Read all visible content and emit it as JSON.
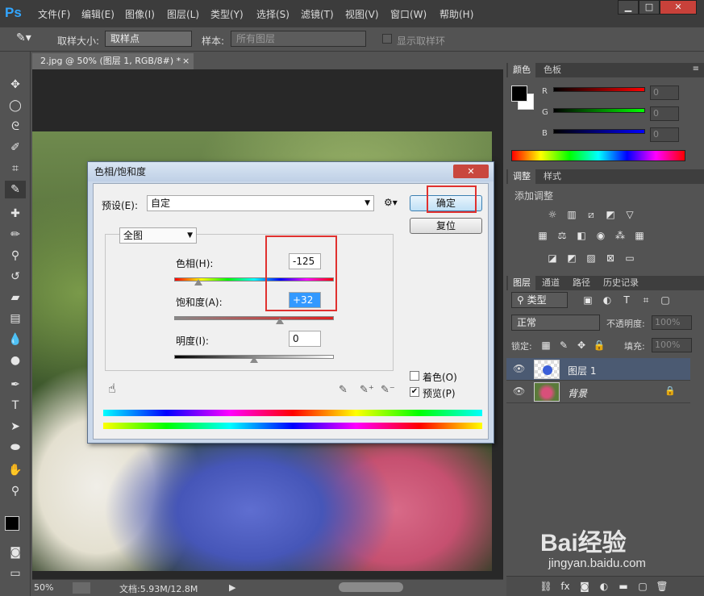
{
  "app": {
    "logo": "Ps"
  },
  "menu": [
    "文件(F)",
    "编辑(E)",
    "图像(I)",
    "图层(L)",
    "类型(Y)",
    "选择(S)",
    "滤镜(T)",
    "视图(V)",
    "窗口(W)",
    "帮助(H)"
  ],
  "window_controls": {
    "minimize": "▁",
    "restore": "□",
    "close": "✕"
  },
  "options": {
    "sample_size_label": "取样大小:",
    "sample_size_value": "取样点",
    "sample_label": "样本:",
    "sample_value": "所有图层",
    "show_ring_label": "显示取样环"
  },
  "document": {
    "tab_title": "2.jpg @ 50% (图层 1, RGB/8#) *",
    "tab_close": "×"
  },
  "status": {
    "zoom": "50%",
    "doc_info": "文档:5.93M/12.8M"
  },
  "color_panel": {
    "tabs": [
      "颜色",
      "色板"
    ],
    "channels": [
      {
        "label": "R",
        "value": "0"
      },
      {
        "label": "G",
        "value": "0"
      },
      {
        "label": "B",
        "value": "0"
      }
    ]
  },
  "adjust_panel": {
    "tabs": [
      "调整",
      "样式"
    ],
    "hint": "添加调整"
  },
  "layers_panel": {
    "tabs": [
      "图层",
      "通道",
      "路径",
      "历史记录"
    ],
    "filter_kind": "类型",
    "blend_mode": "正常",
    "opacity_label": "不透明度:",
    "opacity_value": "100%",
    "lock_label": "锁定:",
    "fill_label": "填充:",
    "fill_value": "100%",
    "layers": [
      {
        "name": "图层 1",
        "selected": true
      },
      {
        "name": "背景",
        "selected": false
      }
    ]
  },
  "dialog": {
    "title": "色相/饱和度",
    "close": "✕",
    "preset_label": "预设(E):",
    "preset_value": "自定",
    "ok_button": "确定",
    "reset_button": "复位",
    "channel_value": "全图",
    "hue_label": "色相(H):",
    "hue_value": "-125",
    "hue_level": -125,
    "saturation_label": "饱和度(A):",
    "saturation_value": "+32",
    "saturation_level": 32,
    "lightness_label": "明度(I):",
    "lightness_value": "0",
    "lightness_level": 0,
    "colorize_label": "着色(O)",
    "colorize_checked": false,
    "preview_label": "预览(P)",
    "preview_checked": true,
    "preview_check_mark": "✔"
  },
  "watermark": {
    "text": "Bai经验",
    "url": "jingyan.baidu.com"
  },
  "colors": {
    "highlight": "#e0312f",
    "accent_blue": "#3399ff",
    "selected_layer": "#4b5a72"
  }
}
